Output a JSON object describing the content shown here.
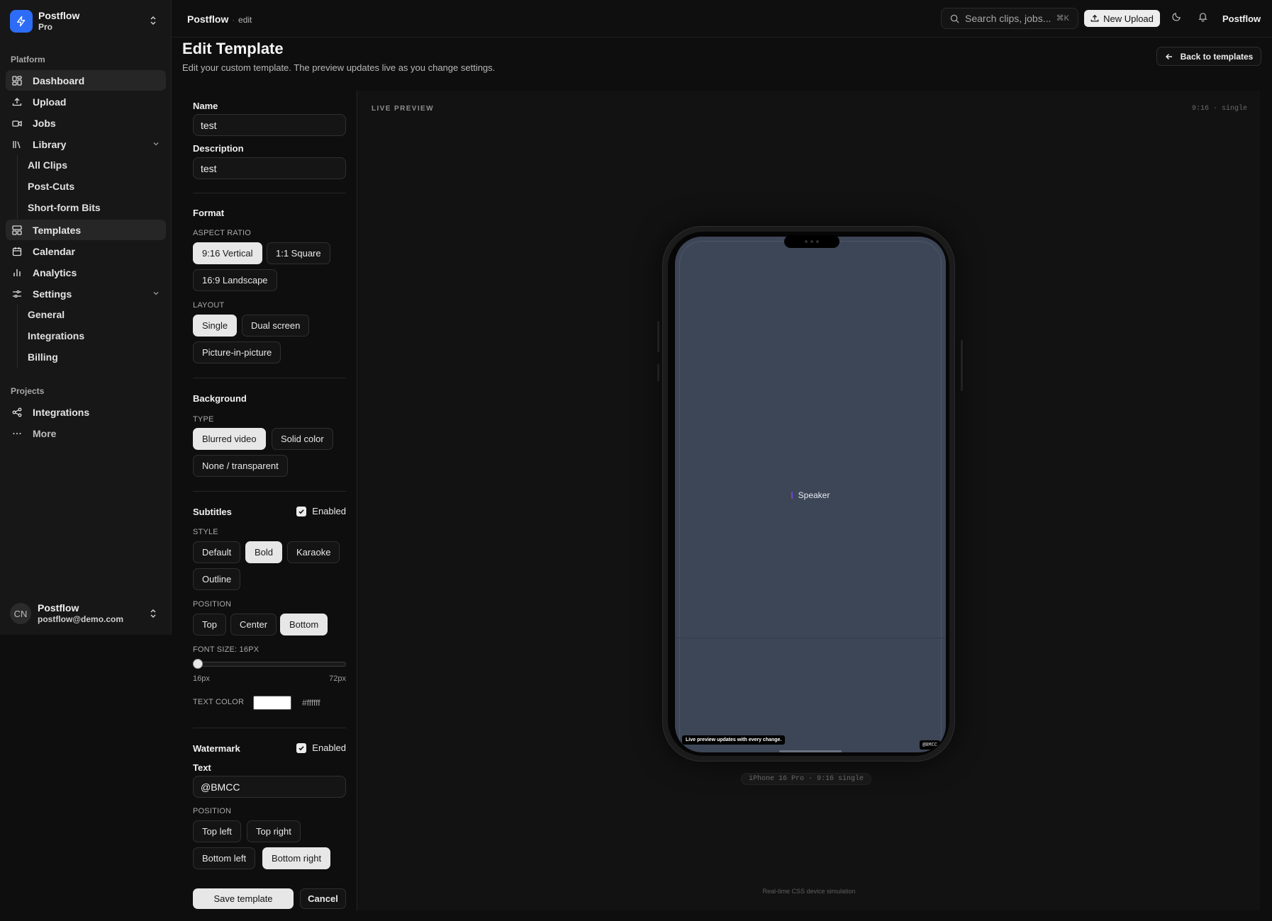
{
  "app": {
    "name": "Postflow",
    "plan": "Pro"
  },
  "sidebar": {
    "platform_label": "Platform",
    "items": [
      {
        "label": "Dashboard",
        "icon": "dashboard-icon",
        "active": true
      },
      {
        "label": "Upload",
        "icon": "upload-icon"
      },
      {
        "label": "Jobs",
        "icon": "video-icon"
      },
      {
        "label": "Library",
        "icon": "library-icon",
        "expanded": true
      },
      {
        "label": "Templates",
        "icon": "templates-icon",
        "active": true
      },
      {
        "label": "Calendar",
        "icon": "calendar-icon"
      },
      {
        "label": "Analytics",
        "icon": "bar-chart-icon"
      },
      {
        "label": "Settings",
        "icon": "settings-sliders-icon",
        "expanded": true
      }
    ],
    "library_children": [
      "All Clips",
      "Post-Cuts",
      "Short-form Bits"
    ],
    "settings_children": [
      "General",
      "Integrations",
      "Billing"
    ],
    "projects_label": "Projects",
    "projects": [
      {
        "label": "Integrations",
        "icon": "share-nodes-icon"
      },
      {
        "label": "More",
        "icon": "more-dots-icon"
      }
    ],
    "user": {
      "initials": "CN",
      "name": "Postflow",
      "email": "postflow@demo.com"
    }
  },
  "topbar": {
    "breadcrumb_main": "Postflow",
    "breadcrumb_sub": "edit",
    "search_placeholder": "Search clips, jobs...",
    "search_shortcut": "⌘K",
    "new_upload_label": "New Upload",
    "user_label": "Postflow"
  },
  "page": {
    "title": "Edit Template",
    "description": "Edit your custom template. The preview updates live as you change settings.",
    "back_label": "Back to templates"
  },
  "form": {
    "name_label": "Name",
    "name_value": "test",
    "description_label": "Description",
    "description_value": "test",
    "format": {
      "title": "Format",
      "aspect_caption": "ASPECT RATIO",
      "aspect_options": [
        "9:16 Vertical",
        "1:1 Square",
        "16:9 Landscape"
      ],
      "aspect_selected": "9:16 Vertical",
      "layout_caption": "LAYOUT",
      "layout_options": [
        "Single",
        "Dual screen",
        "Picture-in-picture"
      ],
      "layout_selected": "Single"
    },
    "background": {
      "title": "Background",
      "type_caption": "TYPE",
      "options": [
        "Blurred video",
        "Solid color",
        "None / transparent"
      ],
      "selected": "Blurred video"
    },
    "subtitles": {
      "title": "Subtitles",
      "enabled_label": "Enabled",
      "enabled": true,
      "style_caption": "STYLE",
      "style_options": [
        "Default",
        "Bold",
        "Karaoke",
        "Outline"
      ],
      "style_selected": "Bold",
      "position_caption": "POSITION",
      "position_options": [
        "Top",
        "Center",
        "Bottom"
      ],
      "position_selected": "Bottom",
      "font_size_label": "FONT SIZE: 16PX",
      "font_size_min": "16px",
      "font_size_max": "72px",
      "font_size_value": 16,
      "font_size_range": [
        16,
        72
      ],
      "text_color_label": "TEXT COLOR",
      "text_color": "#ffffff",
      "text_color_hex_label": "#ffffff"
    },
    "watermark": {
      "title": "Watermark",
      "enabled_label": "Enabled",
      "enabled": true,
      "text_label": "Text",
      "text_value": "@BMCC",
      "position_caption": "POSITION",
      "position_options": [
        "Top left",
        "Top right",
        "Bottom left",
        "Bottom right"
      ],
      "position_selected": "Bottom right"
    },
    "save_label": "Save template",
    "cancel_label": "Cancel"
  },
  "preview": {
    "label": "LIVE PREVIEW",
    "meta": "9:16 · single",
    "speaker_label": "Speaker",
    "caption_text": "Live preview updates with every change.",
    "watermark_text": "@BMCC",
    "device_label": "iPhone 16 Pro · 9:16 single",
    "footer_note": "Real-time CSS device simulation"
  },
  "colors": {
    "brand": "#2d6cf6",
    "screen_bg": "#3c4656",
    "speaker_accent": "#7a3fd6"
  }
}
